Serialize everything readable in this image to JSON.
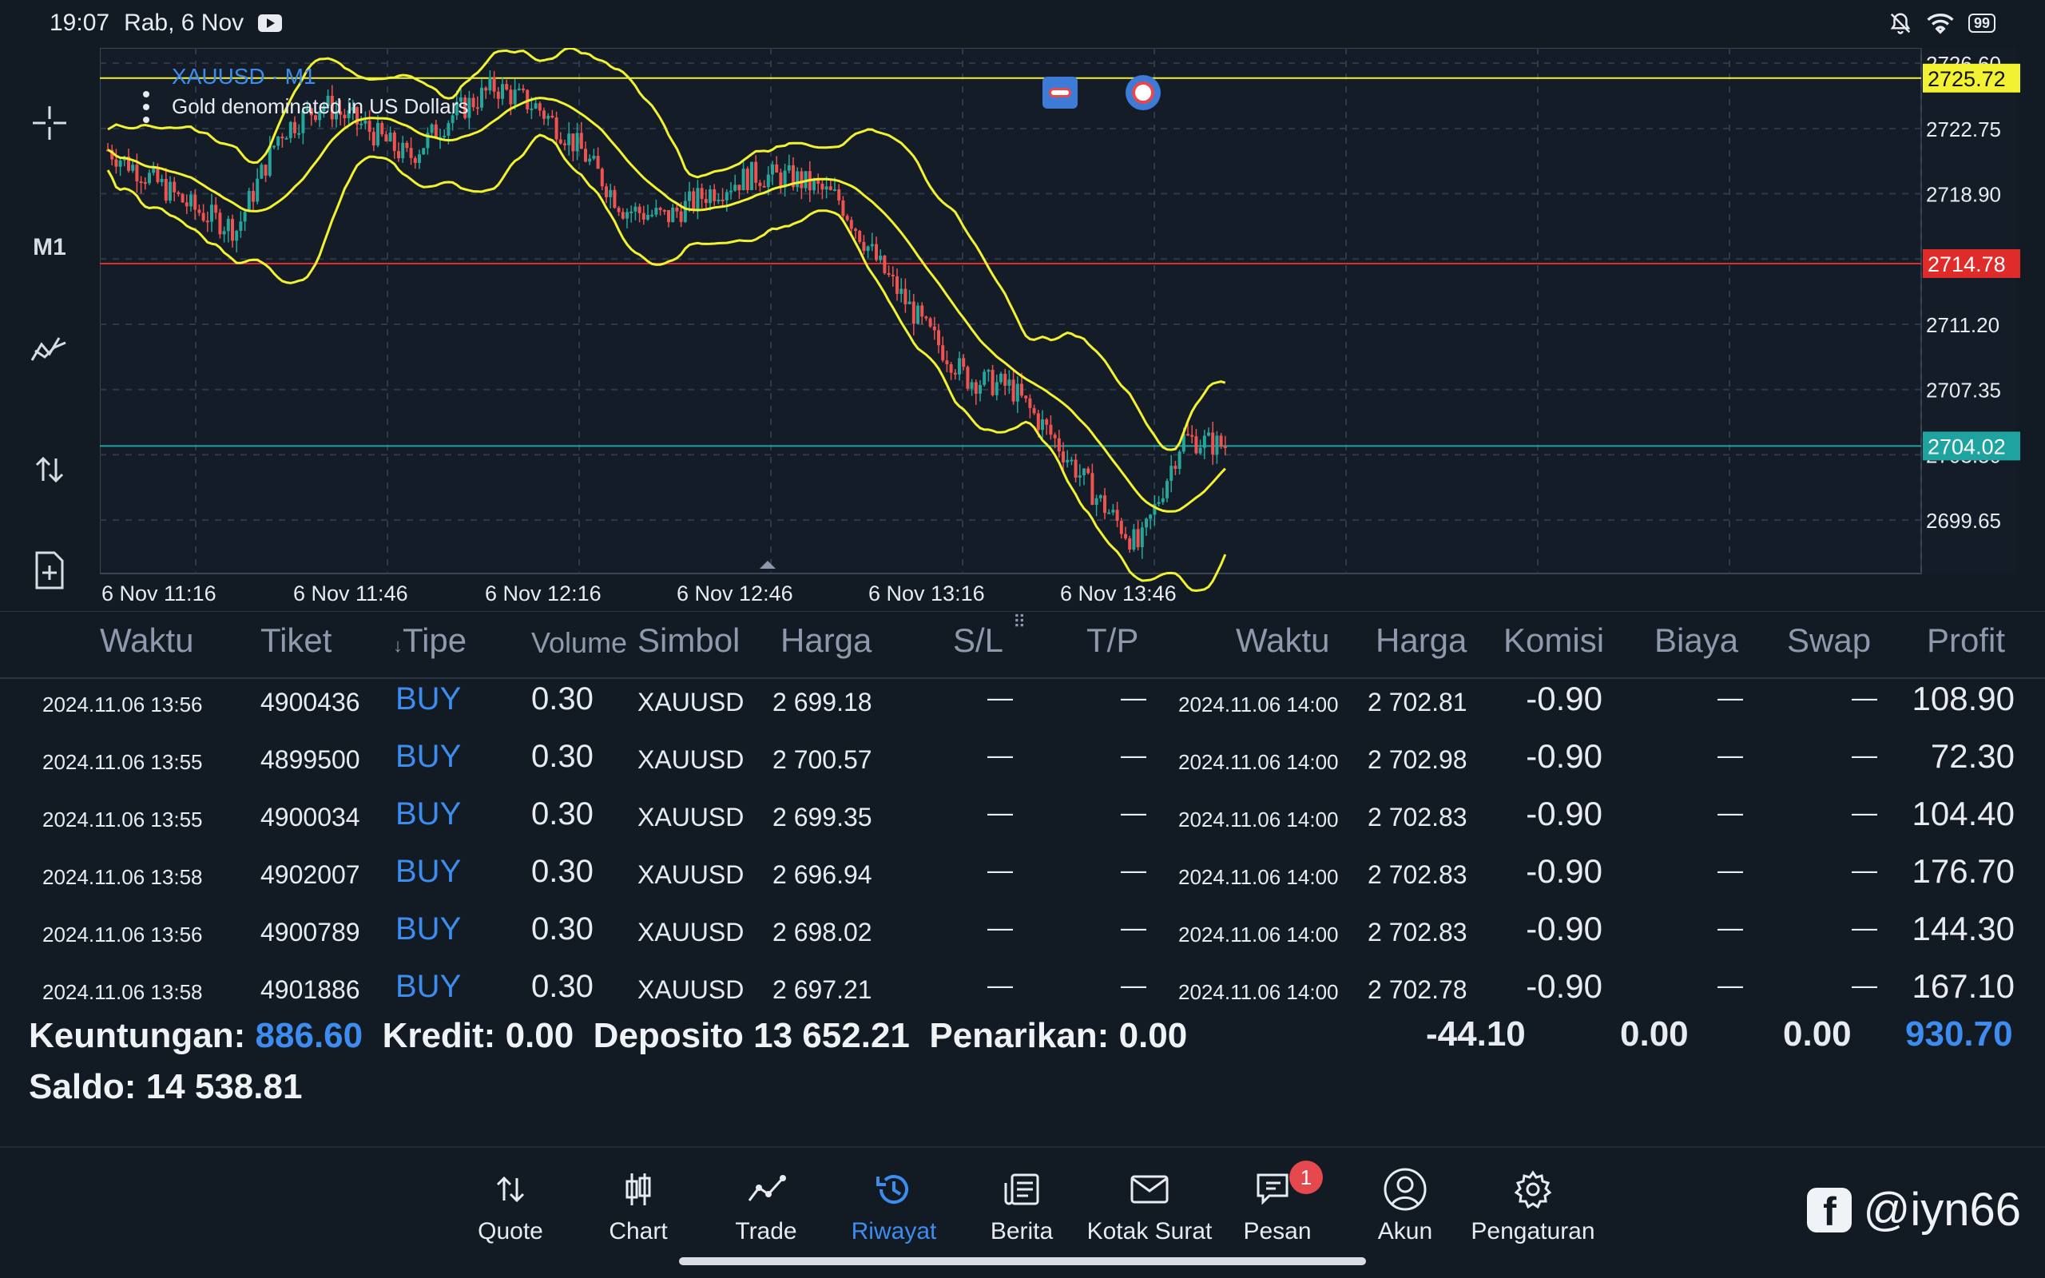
{
  "status_bar": {
    "time": "19:07",
    "date": "Rab, 6 Nov",
    "battery": "99"
  },
  "toolbar": {
    "timeframe": "M1"
  },
  "chart": {
    "symbol_label": "XAUUSD · M1",
    "description": "Gold denominated in US Dollars",
    "price_ticks": [
      "2726.60",
      "2722.75",
      "2718.90",
      "2711.20",
      "2707.35",
      "2703.50",
      "2699.65"
    ],
    "time_ticks": [
      "6 Nov 11:16",
      "6 Nov 11:46",
      "6 Nov 12:16",
      "6 Nov 12:46",
      "6 Nov 13:16",
      "6 Nov 13:46"
    ],
    "price_tags": {
      "top": "2725.72",
      "red": "2714.78",
      "current": "2704.02"
    },
    "colors": {
      "yellow": "#f2f232",
      "red": "#e02b2b",
      "teal": "#1fa3a0",
      "bull": "#26a69a",
      "bear": "#ef5350"
    }
  },
  "chart_data": {
    "type": "candlestick",
    "y_range": [
      2696.5,
      2727.5
    ],
    "levels": [
      2725.72,
      2714.78,
      2704.02
    ],
    "close_path": [
      2721.5,
      2719.8,
      2718.0,
      2716.8,
      2722.5,
      2724.2,
      2722.8,
      2721.0,
      2723.5,
      2725.2,
      2724.0,
      2721.5,
      2718.0,
      2717.5,
      2719.0,
      2720.0,
      2719.8,
      2718.6,
      2714.5,
      2711.0,
      2708.0,
      2707.5,
      2704.5,
      2701.0,
      2698.0,
      2704.5,
      2704.02
    ]
  },
  "table": {
    "headers": [
      "Waktu",
      "Tiket",
      "Tipe",
      "Volume",
      "Simbol",
      "Harga",
      "S/L",
      "T/P",
      "Waktu",
      "Harga",
      "Komisi",
      "Biaya",
      "Swap",
      "Profit"
    ],
    "rows": [
      {
        "open_time": "2024.11.06 13:56",
        "ticket": "4900436",
        "type": "BUY",
        "volume": "0.30",
        "symbol": "XAUUSD",
        "open_price": "2 699.18",
        "sl": "—",
        "tp": "—",
        "close_time": "2024.11.06 14:00",
        "close_price": "2 702.81",
        "commission": "-0.90",
        "fee": "—",
        "swap": "—",
        "profit": "108.90"
      },
      {
        "open_time": "2024.11.06 13:55",
        "ticket": "4899500",
        "type": "BUY",
        "volume": "0.30",
        "symbol": "XAUUSD",
        "open_price": "2 700.57",
        "sl": "—",
        "tp": "—",
        "close_time": "2024.11.06 14:00",
        "close_price": "2 702.98",
        "commission": "-0.90",
        "fee": "—",
        "swap": "—",
        "profit": "72.30"
      },
      {
        "open_time": "2024.11.06 13:55",
        "ticket": "4900034",
        "type": "BUY",
        "volume": "0.30",
        "symbol": "XAUUSD",
        "open_price": "2 699.35",
        "sl": "—",
        "tp": "—",
        "close_time": "2024.11.06 14:00",
        "close_price": "2 702.83",
        "commission": "-0.90",
        "fee": "—",
        "swap": "—",
        "profit": "104.40"
      },
      {
        "open_time": "2024.11.06 13:58",
        "ticket": "4902007",
        "type": "BUY",
        "volume": "0.30",
        "symbol": "XAUUSD",
        "open_price": "2 696.94",
        "sl": "—",
        "tp": "—",
        "close_time": "2024.11.06 14:00",
        "close_price": "2 702.83",
        "commission": "-0.90",
        "fee": "—",
        "swap": "—",
        "profit": "176.70"
      },
      {
        "open_time": "2024.11.06 13:56",
        "ticket": "4900789",
        "type": "BUY",
        "volume": "0.30",
        "symbol": "XAUUSD",
        "open_price": "2 698.02",
        "sl": "—",
        "tp": "—",
        "close_time": "2024.11.06 14:00",
        "close_price": "2 702.83",
        "commission": "-0.90",
        "fee": "—",
        "swap": "—",
        "profit": "144.30"
      },
      {
        "open_time": "2024.11.06 13:58",
        "ticket": "4901886",
        "type": "BUY",
        "volume": "0.30",
        "symbol": "XAUUSD",
        "open_price": "2 697.21",
        "sl": "—",
        "tp": "—",
        "close_time": "2024.11.06 14:00",
        "close_price": "2 702.78",
        "commission": "-0.90",
        "fee": "—",
        "swap": "—",
        "profit": "167.10"
      }
    ]
  },
  "summary": {
    "profit_label": "Keuntungan:",
    "profit_value": "886.60",
    "credit_label": "Kredit:",
    "credit_value": "0.00",
    "deposit_label": "Deposito",
    "deposit_value": "13 652.21",
    "withdrawal_label": "Penarikan:",
    "withdrawal_value": "0.00",
    "balance_label": "Saldo:",
    "balance_value": "14 538.81",
    "total_commission": "-44.10",
    "total_fee": "0.00",
    "total_swap": "0.00",
    "total_profit": "930.70"
  },
  "nav": [
    {
      "label": "Quote",
      "icon": "quote-arrows-icon"
    },
    {
      "label": "Chart",
      "icon": "candles-icon"
    },
    {
      "label": "Trade",
      "icon": "trade-line-icon"
    },
    {
      "label": "Riwayat",
      "icon": "history-clock-icon",
      "active": true
    },
    {
      "label": "Berita",
      "icon": "news-icon"
    },
    {
      "label": "Kotak Surat",
      "icon": "mail-icon"
    },
    {
      "label": "Pesan",
      "icon": "chat-icon",
      "badge": "1"
    },
    {
      "label": "Akun",
      "icon": "account-icon"
    },
    {
      "label": "Pengaturan",
      "icon": "settings-gear-icon"
    }
  ],
  "watermark": {
    "handle": "@iyn66"
  }
}
